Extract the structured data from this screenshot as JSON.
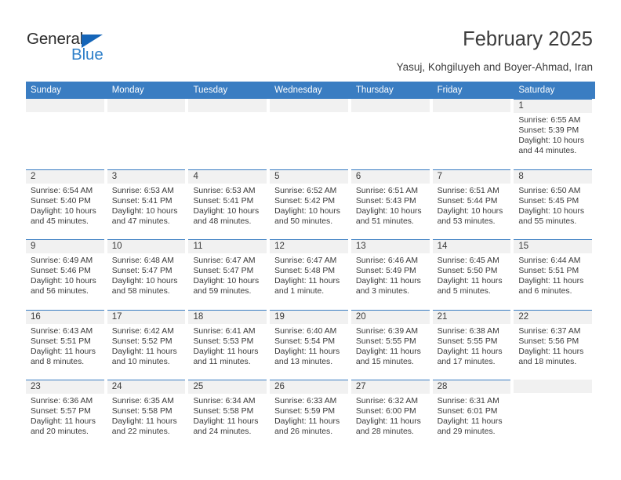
{
  "brand": {
    "name_part1": "General",
    "name_part2": "Blue"
  },
  "header": {
    "title": "February 2025",
    "subtitle": "Yasuj, Kohgiluyeh and Boyer-Ahmad, Iran"
  },
  "colors": {
    "header_blue": "#3a7dc2",
    "logo_blue": "#2e7fc9",
    "day_band": "#f1f1f1",
    "text": "#3a3a3a"
  },
  "weekdays": [
    "Sunday",
    "Monday",
    "Tuesday",
    "Wednesday",
    "Thursday",
    "Friday",
    "Saturday"
  ],
  "weeks": [
    [
      {
        "day": ""
      },
      {
        "day": ""
      },
      {
        "day": ""
      },
      {
        "day": ""
      },
      {
        "day": ""
      },
      {
        "day": ""
      },
      {
        "day": "1",
        "sunrise": "Sunrise: 6:55 AM",
        "sunset": "Sunset: 5:39 PM",
        "daylight1": "Daylight: 10 hours",
        "daylight2": "and 44 minutes."
      }
    ],
    [
      {
        "day": "2",
        "sunrise": "Sunrise: 6:54 AM",
        "sunset": "Sunset: 5:40 PM",
        "daylight1": "Daylight: 10 hours",
        "daylight2": "and 45 minutes."
      },
      {
        "day": "3",
        "sunrise": "Sunrise: 6:53 AM",
        "sunset": "Sunset: 5:41 PM",
        "daylight1": "Daylight: 10 hours",
        "daylight2": "and 47 minutes."
      },
      {
        "day": "4",
        "sunrise": "Sunrise: 6:53 AM",
        "sunset": "Sunset: 5:41 PM",
        "daylight1": "Daylight: 10 hours",
        "daylight2": "and 48 minutes."
      },
      {
        "day": "5",
        "sunrise": "Sunrise: 6:52 AM",
        "sunset": "Sunset: 5:42 PM",
        "daylight1": "Daylight: 10 hours",
        "daylight2": "and 50 minutes."
      },
      {
        "day": "6",
        "sunrise": "Sunrise: 6:51 AM",
        "sunset": "Sunset: 5:43 PM",
        "daylight1": "Daylight: 10 hours",
        "daylight2": "and 51 minutes."
      },
      {
        "day": "7",
        "sunrise": "Sunrise: 6:51 AM",
        "sunset": "Sunset: 5:44 PM",
        "daylight1": "Daylight: 10 hours",
        "daylight2": "and 53 minutes."
      },
      {
        "day": "8",
        "sunrise": "Sunrise: 6:50 AM",
        "sunset": "Sunset: 5:45 PM",
        "daylight1": "Daylight: 10 hours",
        "daylight2": "and 55 minutes."
      }
    ],
    [
      {
        "day": "9",
        "sunrise": "Sunrise: 6:49 AM",
        "sunset": "Sunset: 5:46 PM",
        "daylight1": "Daylight: 10 hours",
        "daylight2": "and 56 minutes."
      },
      {
        "day": "10",
        "sunrise": "Sunrise: 6:48 AM",
        "sunset": "Sunset: 5:47 PM",
        "daylight1": "Daylight: 10 hours",
        "daylight2": "and 58 minutes."
      },
      {
        "day": "11",
        "sunrise": "Sunrise: 6:47 AM",
        "sunset": "Sunset: 5:47 PM",
        "daylight1": "Daylight: 10 hours",
        "daylight2": "and 59 minutes."
      },
      {
        "day": "12",
        "sunrise": "Sunrise: 6:47 AM",
        "sunset": "Sunset: 5:48 PM",
        "daylight1": "Daylight: 11 hours",
        "daylight2": "and 1 minute."
      },
      {
        "day": "13",
        "sunrise": "Sunrise: 6:46 AM",
        "sunset": "Sunset: 5:49 PM",
        "daylight1": "Daylight: 11 hours",
        "daylight2": "and 3 minutes."
      },
      {
        "day": "14",
        "sunrise": "Sunrise: 6:45 AM",
        "sunset": "Sunset: 5:50 PM",
        "daylight1": "Daylight: 11 hours",
        "daylight2": "and 5 minutes."
      },
      {
        "day": "15",
        "sunrise": "Sunrise: 6:44 AM",
        "sunset": "Sunset: 5:51 PM",
        "daylight1": "Daylight: 11 hours",
        "daylight2": "and 6 minutes."
      }
    ],
    [
      {
        "day": "16",
        "sunrise": "Sunrise: 6:43 AM",
        "sunset": "Sunset: 5:51 PM",
        "daylight1": "Daylight: 11 hours",
        "daylight2": "and 8 minutes."
      },
      {
        "day": "17",
        "sunrise": "Sunrise: 6:42 AM",
        "sunset": "Sunset: 5:52 PM",
        "daylight1": "Daylight: 11 hours",
        "daylight2": "and 10 minutes."
      },
      {
        "day": "18",
        "sunrise": "Sunrise: 6:41 AM",
        "sunset": "Sunset: 5:53 PM",
        "daylight1": "Daylight: 11 hours",
        "daylight2": "and 11 minutes."
      },
      {
        "day": "19",
        "sunrise": "Sunrise: 6:40 AM",
        "sunset": "Sunset: 5:54 PM",
        "daylight1": "Daylight: 11 hours",
        "daylight2": "and 13 minutes."
      },
      {
        "day": "20",
        "sunrise": "Sunrise: 6:39 AM",
        "sunset": "Sunset: 5:55 PM",
        "daylight1": "Daylight: 11 hours",
        "daylight2": "and 15 minutes."
      },
      {
        "day": "21",
        "sunrise": "Sunrise: 6:38 AM",
        "sunset": "Sunset: 5:55 PM",
        "daylight1": "Daylight: 11 hours",
        "daylight2": "and 17 minutes."
      },
      {
        "day": "22",
        "sunrise": "Sunrise: 6:37 AM",
        "sunset": "Sunset: 5:56 PM",
        "daylight1": "Daylight: 11 hours",
        "daylight2": "and 18 minutes."
      }
    ],
    [
      {
        "day": "23",
        "sunrise": "Sunrise: 6:36 AM",
        "sunset": "Sunset: 5:57 PM",
        "daylight1": "Daylight: 11 hours",
        "daylight2": "and 20 minutes."
      },
      {
        "day": "24",
        "sunrise": "Sunrise: 6:35 AM",
        "sunset": "Sunset: 5:58 PM",
        "daylight1": "Daylight: 11 hours",
        "daylight2": "and 22 minutes."
      },
      {
        "day": "25",
        "sunrise": "Sunrise: 6:34 AM",
        "sunset": "Sunset: 5:58 PM",
        "daylight1": "Daylight: 11 hours",
        "daylight2": "and 24 minutes."
      },
      {
        "day": "26",
        "sunrise": "Sunrise: 6:33 AM",
        "sunset": "Sunset: 5:59 PM",
        "daylight1": "Daylight: 11 hours",
        "daylight2": "and 26 minutes."
      },
      {
        "day": "27",
        "sunrise": "Sunrise: 6:32 AM",
        "sunset": "Sunset: 6:00 PM",
        "daylight1": "Daylight: 11 hours",
        "daylight2": "and 28 minutes."
      },
      {
        "day": "28",
        "sunrise": "Sunrise: 6:31 AM",
        "sunset": "Sunset: 6:01 PM",
        "daylight1": "Daylight: 11 hours",
        "daylight2": "and 29 minutes."
      },
      {
        "day": ""
      }
    ]
  ]
}
